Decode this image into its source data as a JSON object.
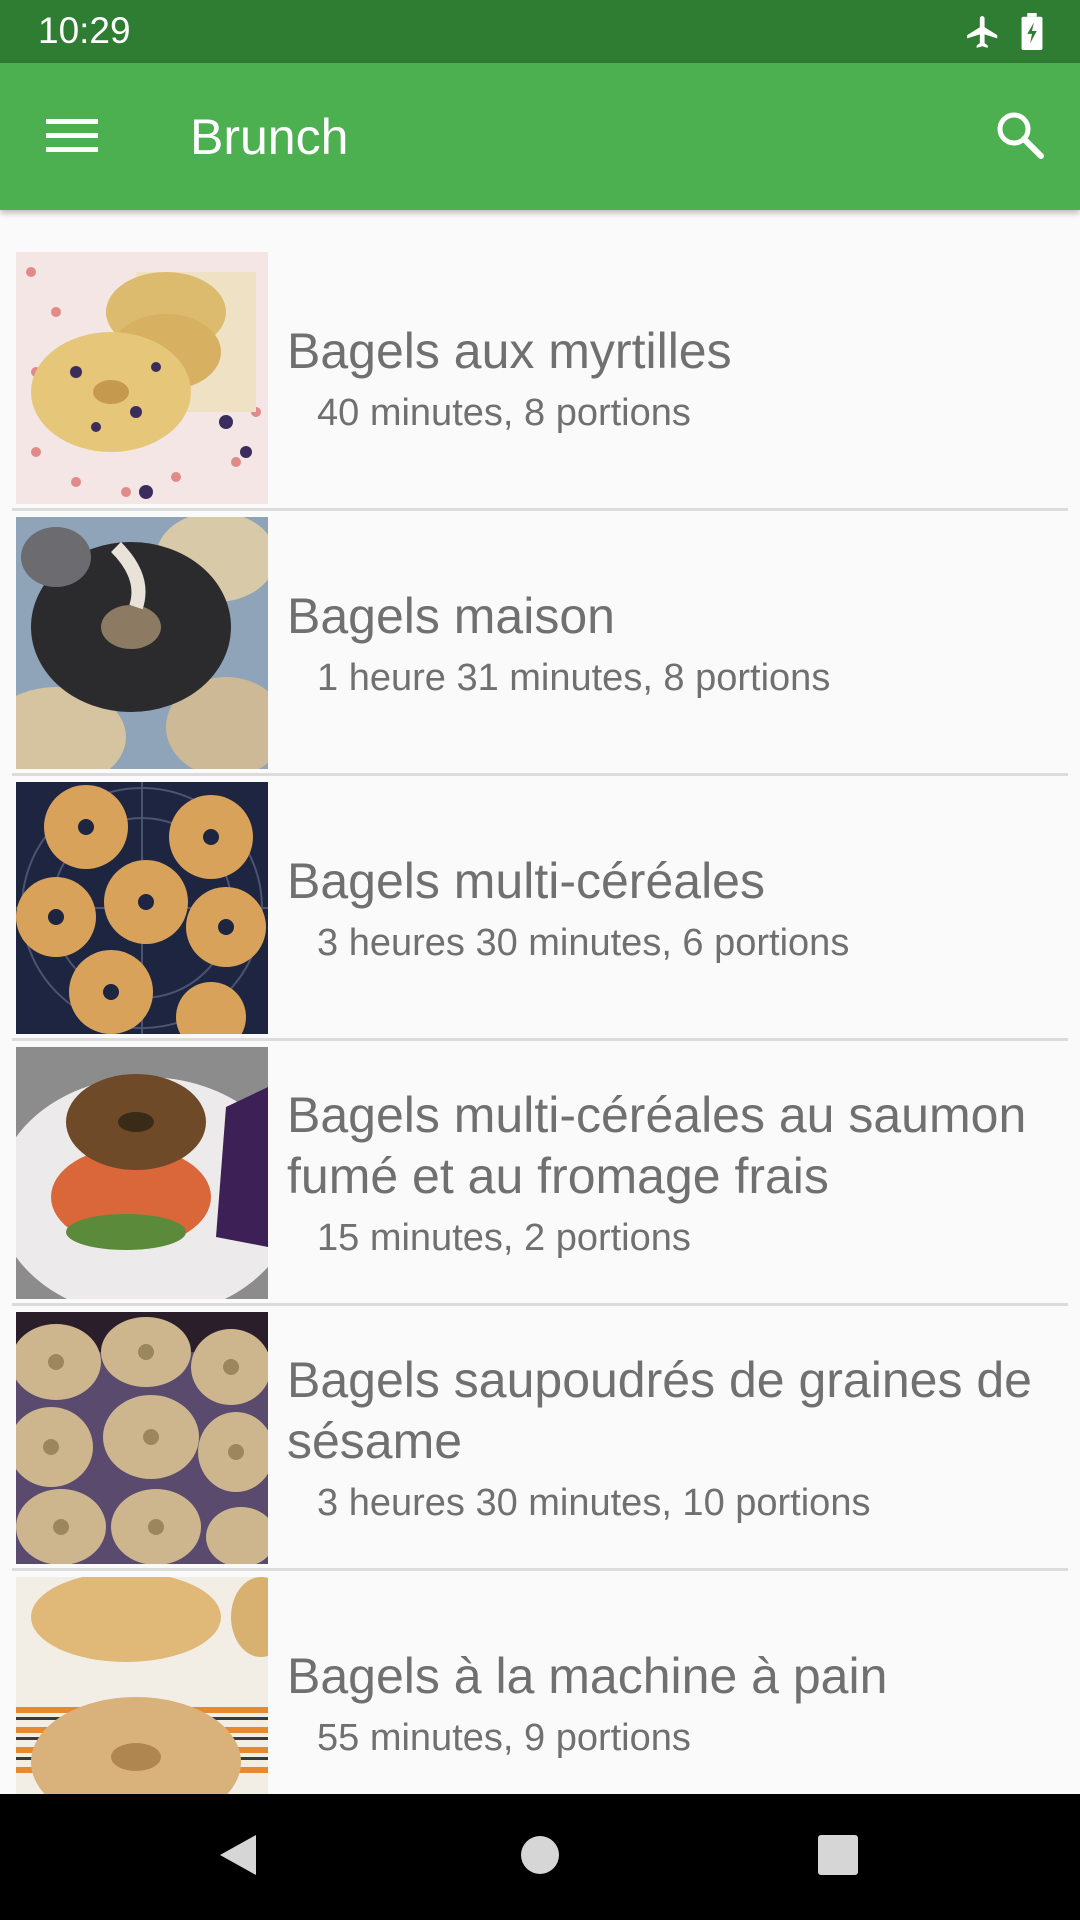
{
  "status_bar": {
    "time": "10:29",
    "icons": [
      "airplane-icon",
      "battery-charging-icon"
    ]
  },
  "app_bar": {
    "title": "Brunch",
    "menu_icon": "hamburger-menu-icon",
    "search_icon": "search-icon"
  },
  "recipes": [
    {
      "title": "Bagels aux myrtilles",
      "subtitle": "40 minutes, 8 portions"
    },
    {
      "title": "Bagels maison",
      "subtitle": "1 heure 31 minutes, 8 portions"
    },
    {
      "title": "Bagels multi-céréales",
      "subtitle": "3 heures 30 minutes, 6 portions"
    },
    {
      "title": "Bagels multi-céréales au saumon fumé et au fromage frais",
      "subtitle": "15 minutes, 2 portions"
    },
    {
      "title": "Bagels saupoudrés de graines de sésame",
      "subtitle": "3 heures 30 minutes, 10 portions"
    },
    {
      "title": "Bagels à la machine à pain",
      "subtitle": "55 minutes, 9 portions"
    }
  ],
  "nav_bar": {
    "buttons": [
      "back-icon",
      "home-icon",
      "recents-icon"
    ]
  },
  "colors": {
    "status_bar": "#2e7d32",
    "app_bar": "#4caf50",
    "text": "#707070",
    "background": "#fafafa"
  }
}
